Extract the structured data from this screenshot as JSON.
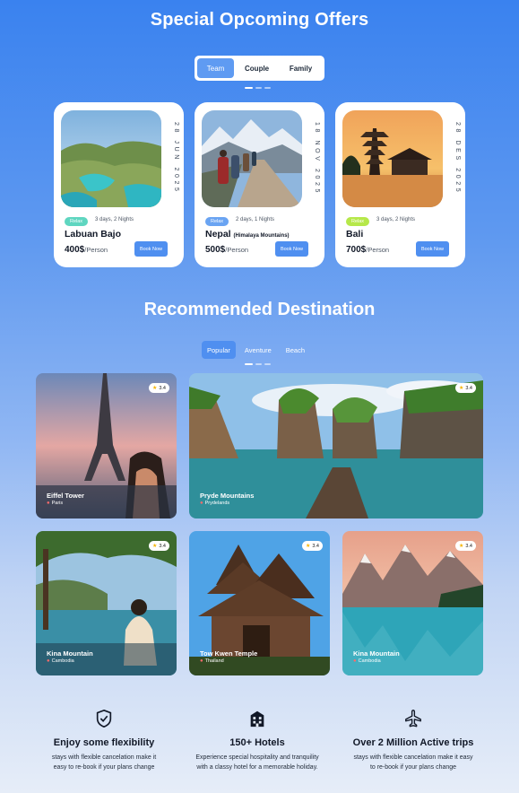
{
  "offers_section": {
    "title": "Special Opcoming Offers",
    "tabs": [
      "Team",
      "Couple",
      "Family"
    ],
    "active_tab": "Team",
    "cards": [
      {
        "date": "28 JUN 2025",
        "tag": "Relax",
        "tag_color": "#5fd6c0",
        "duration": "3 days, 2 Nights",
        "place": "Labuan Bajo",
        "place_note": "",
        "price": "400$",
        "per": "/Person",
        "button": "Book Now"
      },
      {
        "date": "18 NOV 2025",
        "tag": "Relax",
        "tag_color": "#6aa4f2",
        "duration": "2 days, 1 Nights",
        "place": "Nepal",
        "place_note": "(Himalaya Mountains)",
        "price": "500$",
        "per": "/Person",
        "button": "Book Now"
      },
      {
        "date": "28 DES 2025",
        "tag": "Relax",
        "tag_color": "#b6e84a",
        "duration": "3 days, 2 Nights",
        "place": "Bali",
        "place_note": "",
        "price": "700$",
        "per": "/Person",
        "button": "Book Now"
      }
    ]
  },
  "destination_section": {
    "title": "Recommended Destination",
    "tabs": [
      "Popular",
      "Aventure",
      "Beach"
    ],
    "active_tab": "Popular",
    "items": [
      {
        "name": "Eiffel Tower",
        "location": "Paris",
        "rating": "3.4"
      },
      {
        "name": "Pryde Mountains",
        "location": "Prydelands",
        "rating": "3.4"
      },
      {
        "name": "Kina Mountain",
        "location": "Cambodia",
        "rating": "3.4"
      },
      {
        "name": "Tow Kwen Temple",
        "location": "Thailand",
        "rating": "3.4"
      },
      {
        "name": "Kina Mountain",
        "location": "Cambodia",
        "rating": "3.4"
      }
    ]
  },
  "features": [
    {
      "icon": "shield-check-icon",
      "title": "Enjoy some flexibility",
      "desc_line1": "stays with flexible cancelation make it",
      "desc_line2": "easy to re-book if your plans change"
    },
    {
      "icon": "hotel-icon",
      "title": "150+ Hotels",
      "desc_line1": "Experience special hospitality and tranquility",
      "desc_line2": "with a classy hotel for a memorable holiday."
    },
    {
      "icon": "airplane-icon",
      "title": "Over 2 Million Active trips",
      "desc_line1": "stays with flexible cancelation make it easy",
      "desc_line2": "to re-book if your plans change"
    }
  ],
  "colors": {
    "accent": "#4f8ff0",
    "background_top": "#3a82ef",
    "background_bottom": "#e6edf8"
  }
}
